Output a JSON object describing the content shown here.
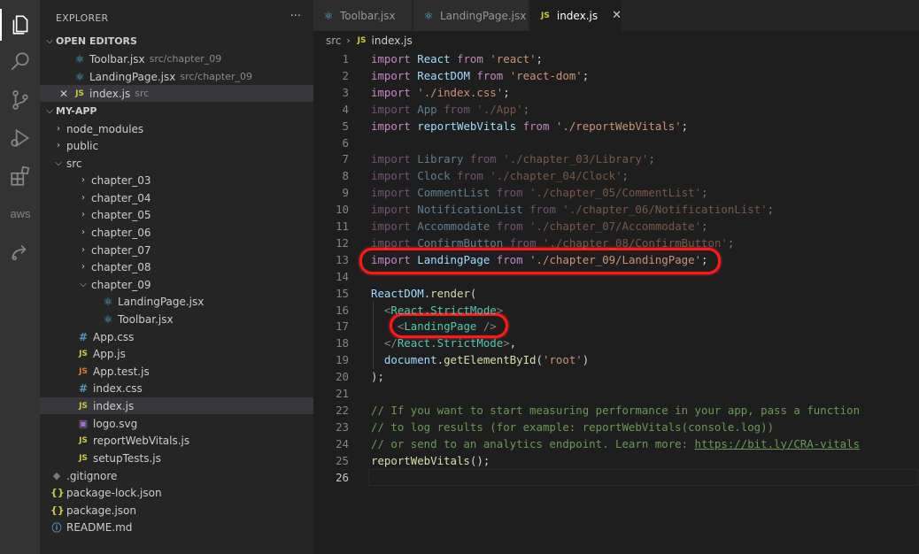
{
  "activity_bar": {
    "icons": [
      "explorer-icon",
      "search-icon",
      "source-control-icon",
      "run-debug-icon",
      "extensions-icon",
      "aws-icon",
      "remote-icon"
    ],
    "aws_label": "aws"
  },
  "sidebar": {
    "title": "EXPLORER",
    "more": "···",
    "open_editors": {
      "header": "OPEN EDITORS",
      "items": [
        {
          "name": "Toolbar.jsx",
          "path": "src/chapter_09"
        },
        {
          "name": "LandingPage.jsx",
          "path": "src/chapter_09"
        },
        {
          "name": "index.js",
          "path": "src"
        }
      ]
    },
    "project": {
      "header": "MY-APP",
      "tree": [
        {
          "label": "node_modules"
        },
        {
          "label": "public"
        },
        {
          "label": "src"
        },
        {
          "label": "chapter_03"
        },
        {
          "label": "chapter_04"
        },
        {
          "label": "chapter_05"
        },
        {
          "label": "chapter_06"
        },
        {
          "label": "chapter_07"
        },
        {
          "label": "chapter_08"
        },
        {
          "label": "chapter_09"
        },
        {
          "label": "LandingPage.jsx"
        },
        {
          "label": "Toolbar.jsx"
        },
        {
          "label": "App.css"
        },
        {
          "label": "App.js"
        },
        {
          "label": "App.test.js"
        },
        {
          "label": "index.css"
        },
        {
          "label": "index.js"
        },
        {
          "label": "logo.svg"
        },
        {
          "label": "reportWebVitals.js"
        },
        {
          "label": "setupTests.js"
        },
        {
          "label": ".gitignore"
        },
        {
          "label": "package-lock.json"
        },
        {
          "label": "package.json"
        },
        {
          "label": "README.md"
        }
      ]
    }
  },
  "tabs": [
    {
      "label": "Toolbar.jsx",
      "active": false
    },
    {
      "label": "LandingPage.jsx",
      "active": false
    },
    {
      "label": "index.js",
      "active": true
    }
  ],
  "breadcrumb": {
    "folder": "src",
    "file": "index.js"
  },
  "editor": {
    "line_numbers": [
      "1",
      "2",
      "3",
      "4",
      "5",
      "6",
      "7",
      "8",
      "9",
      "10",
      "11",
      "12",
      "13",
      "14",
      "15",
      "16",
      "17",
      "18",
      "19",
      "20",
      "21",
      "22",
      "23",
      "24",
      "25",
      "26"
    ],
    "lines": [
      [
        [
          "kw",
          "import"
        ],
        [
          "pl",
          " "
        ],
        [
          "id",
          "React"
        ],
        [
          "pl",
          " "
        ],
        [
          "kw",
          "from"
        ],
        [
          "pl",
          " "
        ],
        [
          "str",
          "'react'"
        ],
        [
          "pl",
          ";"
        ]
      ],
      [
        [
          "kw",
          "import"
        ],
        [
          "pl",
          " "
        ],
        [
          "id",
          "ReactDOM"
        ],
        [
          "pl",
          " "
        ],
        [
          "kw",
          "from"
        ],
        [
          "pl",
          " "
        ],
        [
          "str",
          "'react-dom'"
        ],
        [
          "pl",
          ";"
        ]
      ],
      [
        [
          "kw",
          "import"
        ],
        [
          "pl",
          " "
        ],
        [
          "str",
          "'./index.css'"
        ],
        [
          "pl",
          ";"
        ]
      ],
      [
        [
          "kw dim",
          "import"
        ],
        [
          "pl dim",
          " "
        ],
        [
          "id dim",
          "App"
        ],
        [
          "pl dim",
          " "
        ],
        [
          "kw dim",
          "from"
        ],
        [
          "pl dim",
          " "
        ],
        [
          "str dim",
          "'./App'"
        ],
        [
          "pl dim",
          ";"
        ]
      ],
      [
        [
          "kw",
          "import"
        ],
        [
          "pl",
          " "
        ],
        [
          "id",
          "reportWebVitals"
        ],
        [
          "pl",
          " "
        ],
        [
          "kw",
          "from"
        ],
        [
          "pl",
          " "
        ],
        [
          "str",
          "'./reportWebVitals'"
        ],
        [
          "pl",
          ";"
        ]
      ],
      [],
      [
        [
          "kw dim",
          "import"
        ],
        [
          "pl dim",
          " "
        ],
        [
          "id dim",
          "Library"
        ],
        [
          "pl dim",
          " "
        ],
        [
          "kw dim",
          "from"
        ],
        [
          "pl dim",
          " "
        ],
        [
          "str dim",
          "'./chapter_03/Library'"
        ],
        [
          "pl dim",
          ";"
        ]
      ],
      [
        [
          "kw dim",
          "import"
        ],
        [
          "pl dim",
          " "
        ],
        [
          "id dim",
          "Clock"
        ],
        [
          "pl dim",
          " "
        ],
        [
          "kw dim",
          "from"
        ],
        [
          "pl dim",
          " "
        ],
        [
          "str dim",
          "'./chapter_04/Clock'"
        ],
        [
          "pl dim",
          ";"
        ]
      ],
      [
        [
          "kw dim",
          "import"
        ],
        [
          "pl dim",
          " "
        ],
        [
          "id dim",
          "CommentList"
        ],
        [
          "pl dim",
          " "
        ],
        [
          "kw dim",
          "from"
        ],
        [
          "pl dim",
          " "
        ],
        [
          "str dim",
          "'./chapter_05/CommentList'"
        ],
        [
          "pl dim",
          ";"
        ]
      ],
      [
        [
          "kw dim",
          "import"
        ],
        [
          "pl dim",
          " "
        ],
        [
          "id dim",
          "NotificationList"
        ],
        [
          "pl dim",
          " "
        ],
        [
          "kw dim",
          "from"
        ],
        [
          "pl dim",
          " "
        ],
        [
          "str dim",
          "'./chapter_06/NotificationList'"
        ],
        [
          "pl dim",
          ";"
        ]
      ],
      [
        [
          "kw dim",
          "import"
        ],
        [
          "pl dim",
          " "
        ],
        [
          "id dim",
          "Accommodate"
        ],
        [
          "pl dim",
          " "
        ],
        [
          "kw dim",
          "from"
        ],
        [
          "pl dim",
          " "
        ],
        [
          "str dim",
          "'./chapter_07/Accommodate'"
        ],
        [
          "pl dim",
          ";"
        ]
      ],
      [
        [
          "kw dim",
          "import"
        ],
        [
          "pl dim",
          " "
        ],
        [
          "id dim",
          "ConfirmButton"
        ],
        [
          "pl dim",
          " "
        ],
        [
          "kw dim",
          "from"
        ],
        [
          "pl dim",
          " "
        ],
        [
          "str dim",
          "'./chapter_08/ConfirmButton'"
        ],
        [
          "pl dim",
          ";"
        ]
      ],
      [
        [
          "kw",
          "import"
        ],
        [
          "pl",
          " "
        ],
        [
          "id",
          "LandingPage"
        ],
        [
          "pl",
          " "
        ],
        [
          "kw",
          "from"
        ],
        [
          "pl",
          " "
        ],
        [
          "str",
          "'./chapter_09/LandingPage'"
        ],
        [
          "pl",
          ";"
        ]
      ],
      [],
      [
        [
          "id",
          "ReactDOM"
        ],
        [
          "pl",
          "."
        ],
        [
          "fn",
          "render"
        ],
        [
          "pl",
          "("
        ]
      ],
      [
        [
          "pl",
          "  "
        ],
        [
          "br",
          "<"
        ],
        [
          "tag",
          "React.StrictMode"
        ],
        [
          "br",
          ">"
        ]
      ],
      [
        [
          "pl",
          "    "
        ],
        [
          "br",
          "<"
        ],
        [
          "tag",
          "LandingPage"
        ],
        [
          "pl",
          " "
        ],
        [
          "br",
          "/>"
        ]
      ],
      [
        [
          "pl",
          "  "
        ],
        [
          "br",
          "</"
        ],
        [
          "tag",
          "React.StrictMode"
        ],
        [
          "br",
          ">"
        ],
        [
          "pl",
          ","
        ]
      ],
      [
        [
          "pl",
          "  "
        ],
        [
          "id",
          "document"
        ],
        [
          "pl",
          "."
        ],
        [
          "fn",
          "getElementById"
        ],
        [
          "pl",
          "("
        ],
        [
          "str",
          "'root'"
        ],
        [
          "pl",
          ")"
        ]
      ],
      [
        [
          "pl",
          ");"
        ]
      ],
      [],
      [
        [
          "cm",
          "// If you want to start measuring performance in your app, pass a function"
        ]
      ],
      [
        [
          "cm",
          "// to log results (for example: reportWebVitals(console.log))"
        ]
      ],
      [
        [
          "cm",
          "// or send to an analytics endpoint. Learn more: "
        ],
        [
          "cm link",
          "https://bit.ly/CRA-vitals"
        ]
      ],
      [
        [
          "fn",
          "reportWebVitals"
        ],
        [
          "pl",
          "();"
        ]
      ],
      []
    ]
  },
  "colors": {
    "highlight": "#ff1a1a",
    "keyword": "#c586c0",
    "string": "#ce9178",
    "variable": "#9cdcfe",
    "comment": "#6a9955"
  }
}
